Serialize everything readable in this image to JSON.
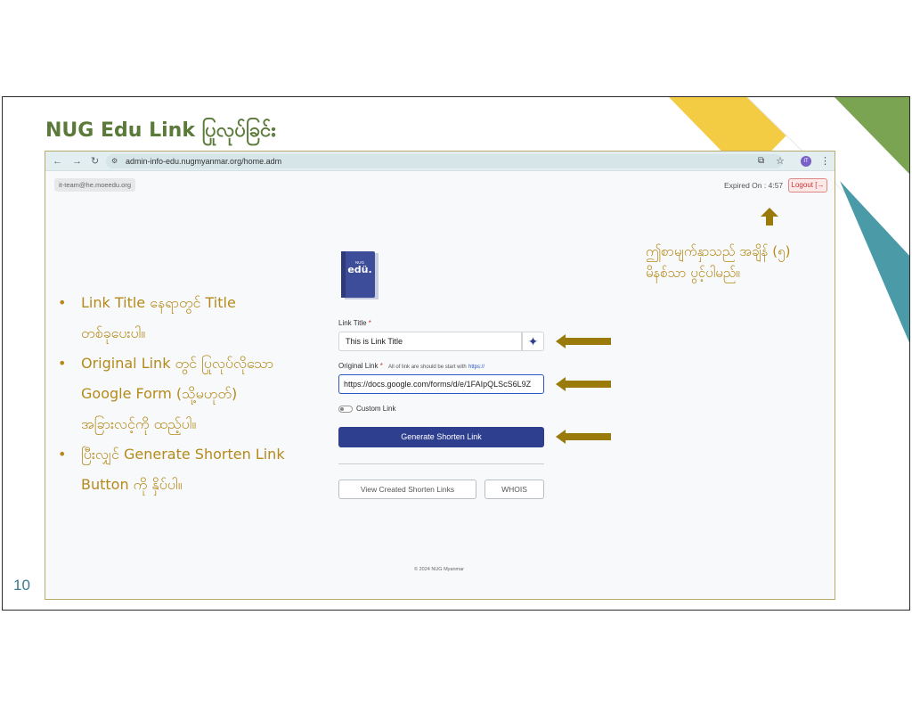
{
  "slide": {
    "title": "NUG Edu Link ပြုလုပ်ခြင်း",
    "page_number": "10",
    "colors": {
      "title": "#5b7a3a",
      "annotation": "#b58a1a",
      "arrow": "#9a7a0a"
    }
  },
  "browser": {
    "url": "admin-info-edu.nugmyanmar.org/home.adm",
    "back_icon": "back-arrow-icon",
    "forward_icon": "forward-arrow-icon",
    "reload_icon": "reload-icon",
    "profile_initials": "IT"
  },
  "app": {
    "user_email": "it-team@he.moeedu.org",
    "expiry": "Expired On : 4:57",
    "logout_label": "Logout",
    "logo_text": "edü.",
    "logo_small": "NUG",
    "link_title_label": "Link Title",
    "link_title_value": "This is Link Title",
    "original_link_label": "Original Link",
    "original_link_hint": "All of link are should be start with",
    "original_link_hint_link": "https://",
    "original_link_value": "https://docs.google.com/forms/d/e/1FAIpQLScS6L9Z",
    "custom_link_label": "Custom Link",
    "generate_label": "Generate Shorten Link",
    "view_links_label": "View Created Shorten Links",
    "whois_label": "WHOIS",
    "footer": "© 2024 NUG Myanmar",
    "accent": "#2e3f8f"
  },
  "annotations": {
    "bullet_1_line_1": "Link Title နေရာတွင် Title",
    "bullet_1_line_2": "တစ်ခုပေးပါ။",
    "bullet_2_line_1": "Original Link တွင် ပြုလုပ်လိုသော",
    "bullet_2_line_2": "Google Form (သို့မဟုတ်)",
    "bullet_2_line_3": "အခြားလင့်ကို ထည့်ပါ။",
    "bullet_3_line_1": "ပြီးလျှင် Generate Shorten Link",
    "bullet_3_line_2": "Button ကို နှိပ်ပါ။",
    "callout_line_1": "ဤစာမျက်နှာသည် အချိန် (၅)",
    "callout_line_2": "မိနစ်သာ ပွင့်ပါမည်။"
  }
}
